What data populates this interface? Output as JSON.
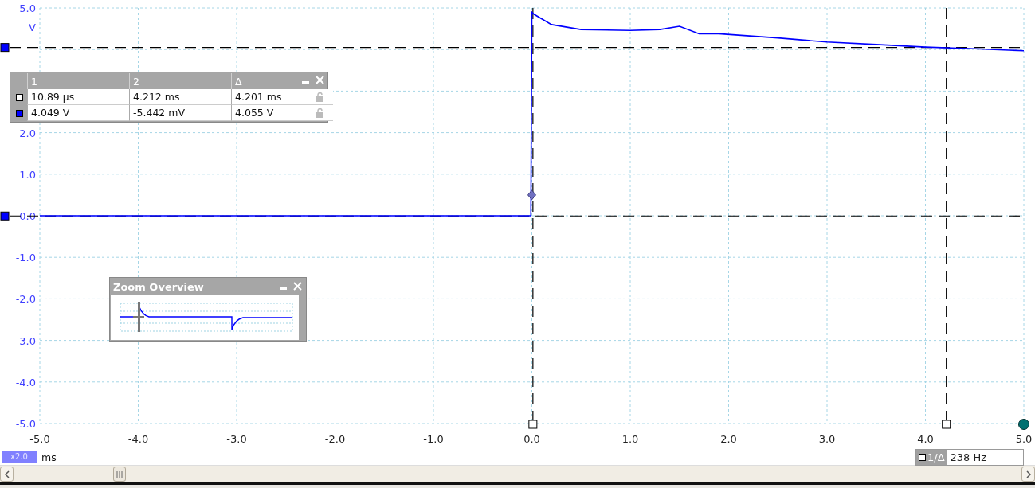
{
  "scope": {
    "chart_data": {
      "type": "line",
      "xlabel": "ms",
      "ylabel": "V",
      "xlim": [
        -5,
        5
      ],
      "ylim": [
        -5,
        5
      ],
      "x": [
        -5,
        -4,
        -3,
        -2,
        -1,
        -0.01,
        0,
        0.02,
        0.2,
        0.5,
        1.0,
        1.3,
        1.5,
        1.7,
        1.9,
        2.5,
        3.0,
        3.5,
        4.0,
        4.5,
        5.0
      ],
      "series": [
        {
          "color": "#0000ff",
          "values": [
            0,
            0,
            0,
            0,
            0,
            0,
            4.9,
            4.85,
            4.6,
            4.48,
            4.46,
            4.48,
            4.56,
            4.38,
            4.38,
            4.28,
            4.18,
            4.12,
            4.06,
            4.02,
            3.97
          ]
        }
      ],
      "xticks": [
        {
          "value": -5,
          "label": "-5.0"
        },
        {
          "value": -4,
          "label": "-4.0"
        },
        {
          "value": -3,
          "label": "-3.0"
        },
        {
          "value": -2,
          "label": "-2.0"
        },
        {
          "value": -1,
          "label": "-1.0"
        },
        {
          "value": 0,
          "label": "0.0"
        },
        {
          "value": 1,
          "label": "1.0"
        },
        {
          "value": 2,
          "label": "2.0"
        },
        {
          "value": 3,
          "label": "3.0"
        },
        {
          "value": 4,
          "label": "4.0"
        },
        {
          "value": 5,
          "label": "5.0"
        }
      ],
      "yticks": [
        {
          "value": 5,
          "label": "5.0"
        },
        {
          "value": 2,
          "label": "2.0"
        },
        {
          "value": 1,
          "label": "1.0"
        },
        {
          "value": 0,
          "label": "0.0"
        },
        {
          "value": -1,
          "label": "-1.0"
        },
        {
          "value": -2,
          "label": "-2.0"
        },
        {
          "value": -3,
          "label": "-3.0"
        },
        {
          "value": -4,
          "label": "-4.0"
        },
        {
          "value": -5,
          "label": "-5.0"
        }
      ],
      "grid": true
    },
    "zoom_factor": "x2.0"
  },
  "ruler_table": {
    "columns": [
      "1",
      "2",
      "Δ"
    ],
    "rows": [
      {
        "kind": "time",
        "cells": [
          "10.89 µs",
          "4.212 ms",
          "4.201 ms"
        ]
      },
      {
        "kind": "voltage",
        "cells": [
          "4.049 V",
          "-5.442 mV",
          "4.055 V"
        ]
      }
    ]
  },
  "zoom_overview": {
    "title": "Zoom Overview"
  },
  "frequency": {
    "label": "1/Δ",
    "value": "238 Hz"
  }
}
